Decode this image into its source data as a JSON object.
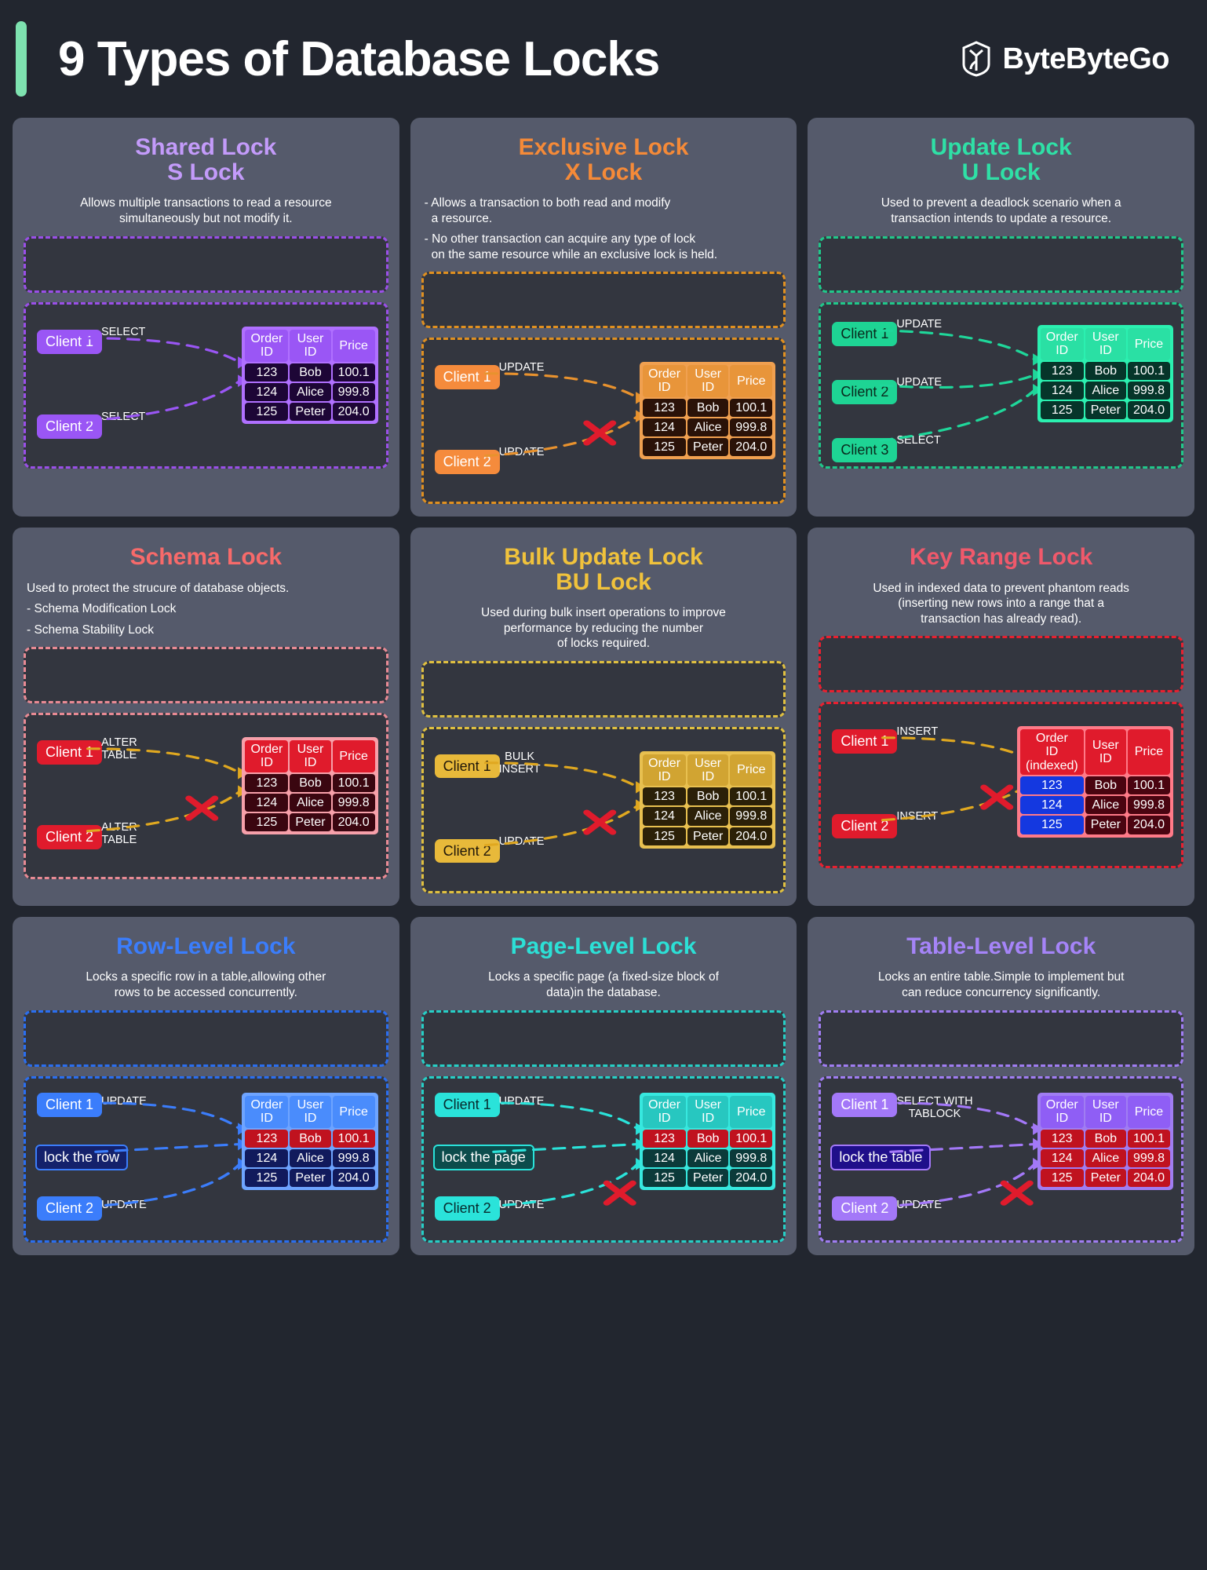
{
  "header": {
    "title": "9 Types of Database Locks",
    "brand": "ByteByteGo",
    "accent_color": "#7ee2b0",
    "background": "#22262f"
  },
  "table_headers": {
    "order": "Order\nID",
    "order_indexed": "Order\nID\n(indexed)",
    "user": "User\nID",
    "price": "Price"
  },
  "rows": [
    {
      "order": "123",
      "user": "Bob",
      "price": "100.1"
    },
    {
      "order": "124",
      "user": "Alice",
      "price": "999.8"
    },
    {
      "order": "125",
      "user": "Peter",
      "price": "204.0"
    }
  ],
  "cards": [
    {
      "id": "shared-lock",
      "title": "Shared Lock",
      "subtitle": "S Lock",
      "accent": "#c39bfa",
      "desc_align": "center",
      "desc_lines": [
        "Allows multiple transactions to read a resource",
        "simultaneously but not modify it."
      ],
      "bullets": [],
      "panel_border": "#9a4fe8",
      "chip_bg": "#9a56f5",
      "chip_color": "#ffffff",
      "clients": [
        "Client 1",
        "Client 2"
      ],
      "ops": [
        "SELECT",
        "SELECT"
      ],
      "arrow_color": "#9a56f5",
      "table": {
        "header_bg": "#9a56f5",
        "cell_bg": "#1d0636",
        "border": "#b070ff",
        "header_labels": [
          "Order\nID",
          "User\nID",
          "Price"
        ]
      },
      "blocked": false,
      "lockbox": null,
      "third_client": null
    },
    {
      "id": "exclusive-lock",
      "title": "Exclusive Lock",
      "subtitle": "X Lock",
      "accent": "#f58a38",
      "desc_align": "left",
      "desc_lines": [],
      "bullets": [
        [
          "- Allows a transaction to both read and modify",
          "a resource."
        ],
        [
          "- No other transaction can acquire any type of lock",
          "on the same resource while an exclusive lock is held."
        ]
      ],
      "panel_border": "#e09020",
      "chip_bg": "#f58b3c",
      "chip_color": "#ffffff",
      "clients": [
        "Client 1",
        "Client 2"
      ],
      "ops": [
        "UPDATE",
        "UPDATE"
      ],
      "arrow_color": "#e8922e",
      "table": {
        "header_bg": "#e8953a",
        "cell_bg": "#2a1208",
        "border": "#f0a050",
        "header_labels": [
          "Order\nID",
          "User\nID",
          "Price"
        ]
      },
      "blocked": true,
      "lockbox": null,
      "third_client": null
    },
    {
      "id": "update-lock",
      "title": "Update Lock",
      "subtitle": "U Lock",
      "accent": "#2fe0a6",
      "desc_align": "center",
      "desc_lines": [
        "Used to prevent a deadlock scenario when a",
        "transaction intends to update a resource."
      ],
      "bullets": [],
      "panel_border": "#20c88a",
      "chip_bg": "#1ed494",
      "chip_color": "#09281c",
      "clients": [
        "Client 1",
        "Client 2",
        "Client 3"
      ],
      "ops": [
        "UPDATE",
        "UPDATE",
        "SELECT"
      ],
      "arrow_color": "#1fd79a",
      "table": {
        "header_bg": "#2ae0a4",
        "cell_bg": "#06352a",
        "border": "#2bf0b0",
        "header_labels": [
          "Order\nID",
          "User\nID",
          "Price"
        ]
      },
      "blocked": false,
      "lockbox": null,
      "third_client": "Client 3"
    },
    {
      "id": "schema-lock",
      "title": "Schema Lock",
      "subtitle": "",
      "accent": "#f76a6a",
      "desc_align": "left",
      "desc_lines": [
        "Used to protect the strucure of database objects."
      ],
      "bullets": [
        [
          "- Schema Modification Lock"
        ],
        [
          "- Schema Stability Lock"
        ]
      ],
      "panel_border": "#e88a94",
      "chip_bg": "#e01b2c",
      "chip_color": "#ffffff",
      "clients": [
        "Client 1",
        "Client 2"
      ],
      "ops": [
        "ALTER\nTABLE",
        "ALTER\nTABLE"
      ],
      "arrow_color": "#e0a820",
      "table": {
        "header_bg": "#e01b2c",
        "cell_bg": "#3a0610",
        "border": "#f7a0aa",
        "header_labels": [
          "Order\nID",
          "User\nID",
          "Price"
        ]
      },
      "blocked": true,
      "lockbox": null,
      "third_client": null
    },
    {
      "id": "bulk-update-lock",
      "title": "Bulk Update Lock",
      "subtitle": "BU Lock",
      "accent": "#f0c23c",
      "desc_align": "center",
      "desc_lines": [
        "Used during bulk insert operations to improve",
        "performance by reducing the number",
        "of locks required."
      ],
      "bullets": [],
      "panel_border": "#e0c040",
      "chip_bg": "#e8b93a",
      "chip_color": "#20170a",
      "clients": [
        "Client 1",
        "Client 2"
      ],
      "ops": [
        "BULK\nINSERT",
        "UPDATE"
      ],
      "arrow_color": "#e0a820",
      "table": {
        "header_bg": "#d1a432",
        "cell_bg": "#2b2008",
        "border": "#e8c050",
        "header_labels": [
          "Order\nID",
          "User\nID",
          "Price"
        ]
      },
      "blocked": true,
      "lockbox": null,
      "third_client": null
    },
    {
      "id": "key-range-lock",
      "title": "Key Range Lock",
      "subtitle": "",
      "accent": "#f0596b",
      "desc_align": "center",
      "desc_lines": [
        "Used in indexed data to prevent phantom reads",
        "(inserting new rows into a range that a",
        "transaction has already read)."
      ],
      "bullets": [],
      "panel_border": "#e82030",
      "chip_bg": "#e01b2c",
      "chip_color": "#ffffff",
      "clients": [
        "Client 1",
        "Client 2"
      ],
      "ops": [
        "INSERT",
        "INSERT"
      ],
      "arrow_color": "#e0a820",
      "table": {
        "header_bg": "#e01b2c",
        "cell_bg": "#4a0410",
        "border": "#ff7a88",
        "header_labels": [
          "Order\nID\n(indexed)",
          "User\nID",
          "Price"
        ],
        "first_col_bg": "#1438e0"
      },
      "blocked": true,
      "lockbox": null,
      "third_client": null
    },
    {
      "id": "row-level-lock",
      "title": "Row-Level Lock",
      "subtitle": "",
      "accent": "#3b7dfb",
      "desc_align": "center",
      "desc_lines": [
        "Locks a specific row in a table,allowing other",
        "rows to be accessed concurrently."
      ],
      "bullets": [],
      "panel_border": "#2a6ef0",
      "chip_bg": "#3b7dfb",
      "chip_color": "#ffffff",
      "clients": [
        "Client 1",
        "Client 2"
      ],
      "ops": [
        "UPDATE",
        "UPDATE"
      ],
      "arrow_color": "#3b7dfb",
      "table": {
        "header_bg": "#4a8cfc",
        "cell_bg": "#111a5c",
        "border": "#6ea4ff",
        "header_labels": [
          "Order\nID",
          "User\nID",
          "Price"
        ],
        "locked_row": 0,
        "locked_bg": "#c0121f"
      },
      "blocked": false,
      "lockbox": "lock the row",
      "lockbox_bg": "#14216b",
      "third_client": null
    },
    {
      "id": "page-level-lock",
      "title": "Page-Level Lock",
      "subtitle": "",
      "accent": "#2ce0d6",
      "desc_align": "center",
      "desc_lines": [
        "Locks a specific page (a fixed-size block of",
        "data)in the database."
      ],
      "bullets": [],
      "panel_border": "#26cfc6",
      "chip_bg": "#2ae3da",
      "chip_color": "#07292c",
      "clients": [
        "Client 1",
        "Client 2"
      ],
      "ops": [
        "UPDATE",
        "UPDATE"
      ],
      "arrow_color": "#2ae3da",
      "table": {
        "header_bg": "#27c7c0",
        "cell_bg": "#0b3a3a",
        "border": "#37e8df",
        "header_labels": [
          "Order\nID",
          "User\nID",
          "Price"
        ],
        "locked_row": 0,
        "locked_bg": "#c0121f"
      },
      "blocked": true,
      "lockbox": "lock the page",
      "lockbox_bg": "#0c4c4c",
      "third_client": null
    },
    {
      "id": "table-level-lock",
      "title": "Table-Level Lock",
      "subtitle": "",
      "accent": "#a584f8",
      "desc_align": "center",
      "desc_lines": [
        "Locks an entire table.Simple to implement but",
        "can reduce concurrency significantly."
      ],
      "bullets": [],
      "panel_border": "#a07df2",
      "chip_bg": "#a378f8",
      "chip_color": "#ffffff",
      "clients": [
        "Client 1",
        "Client 2"
      ],
      "ops": [
        "SELECT WITH\nTABLOCK",
        "UPDATE"
      ],
      "arrow_color": "#a378f8",
      "table": {
        "header_bg": "#8f5ef5",
        "cell_bg": "#c0121f",
        "border": "#a07df2",
        "header_labels": [
          "Order\nID",
          "User\nID",
          "Price"
        ],
        "all_locked": true
      },
      "blocked": true,
      "lockbox": "lock the table",
      "lockbox_bg": "#1f0f8a",
      "third_client": null
    }
  ]
}
